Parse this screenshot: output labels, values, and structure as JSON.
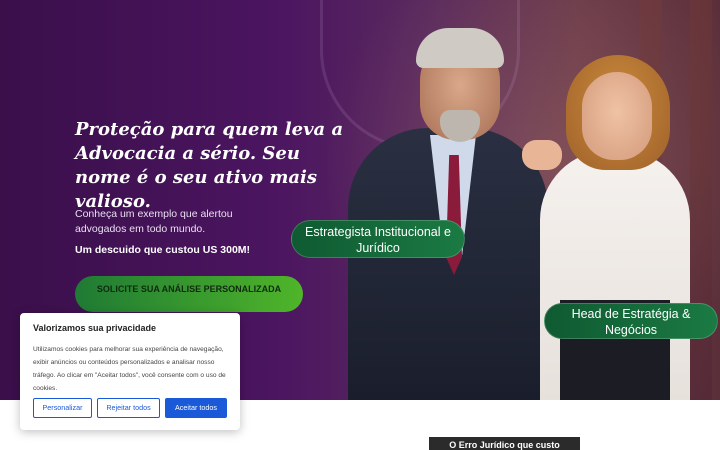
{
  "hero": {
    "headline": "Proteção para quem leva a Advocacia a sério. Seu nome é o seu ativo mais valioso.",
    "description": "Conheça um exemplo que alertou advogados em todo mundo.",
    "loss_text": "Um descuido que custou US 300M!",
    "cta_label": "SOLICITE SUA ANÁLISE PERSONALIZADA",
    "badge_left": "Estrategista Institucional e Jurídico",
    "badge_right": "Head de Estratégia & Negócios"
  },
  "video": {
    "caption": "O Erro Jurídico que custo"
  },
  "cookie_banner": {
    "title": "Valorizamos sua privacidade",
    "text": "Utilizamos cookies para melhorar sua experiência de navegação, exibir anúncios ou conteúdos personalizados e analisar nosso tráfego. Ao clicar em \"Aceitar todos\", você consente com o uso de cookies.",
    "customize_label": "Personalizar",
    "reject_label": "Rejeitar todos",
    "accept_label": "Aceitar todos"
  },
  "colors": {
    "hero_purple": "#4b1560",
    "badge_green": "#1b7a43",
    "cta_green": "#4fb529",
    "cookie_accent": "#1a5ad9"
  }
}
